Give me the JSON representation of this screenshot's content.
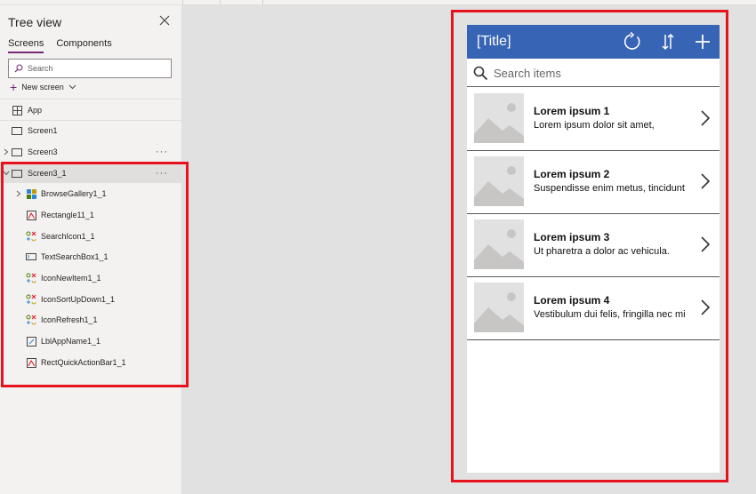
{
  "tree": {
    "header": "Tree view",
    "tabs": [
      {
        "label": "Screens",
        "active": true
      },
      {
        "label": "Components",
        "active": false
      }
    ],
    "search_placeholder": "Search",
    "new_screen_label": "New screen",
    "items": [
      {
        "label": "App",
        "icon": "app-icon"
      },
      {
        "label": "Screen1",
        "icon": "screen-icon"
      },
      {
        "label": "Screen3",
        "icon": "screen-icon"
      },
      {
        "label": "Screen3_1",
        "icon": "screen-icon",
        "selected": true
      },
      {
        "label": "BrowseGallery1_1",
        "icon": "gallery-icon"
      },
      {
        "label": "Rectangle11_1",
        "icon": "rectangle-icon"
      },
      {
        "label": "SearchIcon1_1",
        "icon": "icon-control-icon"
      },
      {
        "label": "TextSearchBox1_1",
        "icon": "textbox-icon"
      },
      {
        "label": "IconNewItem1_1",
        "icon": "icon-control-icon"
      },
      {
        "label": "IconSortUpDown1_1",
        "icon": "icon-control-icon"
      },
      {
        "label": "IconRefresh1_1",
        "icon": "icon-control-icon"
      },
      {
        "label": "LblAppName1_1",
        "icon": "label-icon"
      },
      {
        "label": "RectQuickActionBar1_1",
        "icon": "rectangle-icon"
      }
    ]
  },
  "phone": {
    "title": "[Title]",
    "search_placeholder": "Search items",
    "items": [
      {
        "title": "Lorem ipsum 1",
        "subtitle": "Lorem ipsum dolor sit amet,"
      },
      {
        "title": "Lorem ipsum 2",
        "subtitle": "Suspendisse enim metus, tincidunt"
      },
      {
        "title": "Lorem ipsum 3",
        "subtitle": "Ut pharetra a dolor ac vehicula."
      },
      {
        "title": "Lorem ipsum 4",
        "subtitle": "Vestibulum dui felis, fringilla nec mi"
      }
    ]
  },
  "colors": {
    "accent": "#742774",
    "titlebar": "#3864b5",
    "highlight": "#e8121c"
  }
}
